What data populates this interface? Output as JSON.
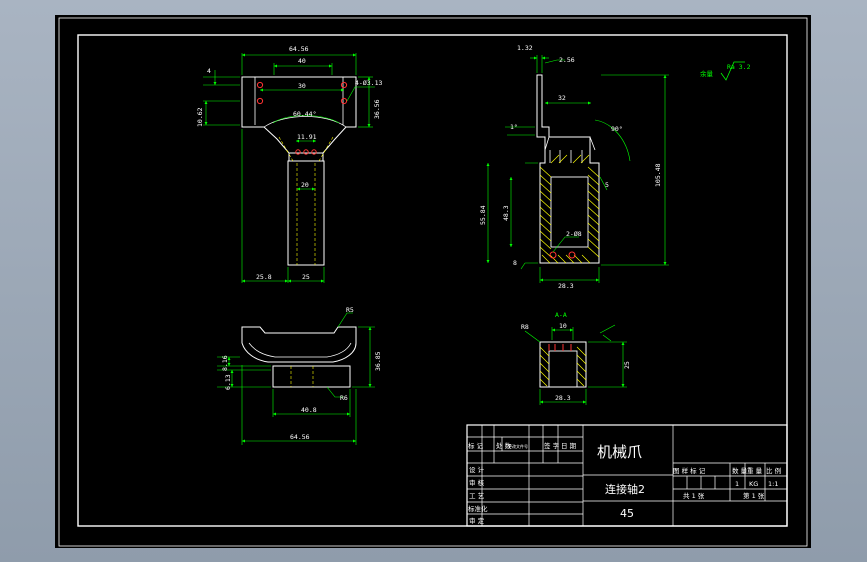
{
  "window": {
    "background": "#a9b4c2"
  },
  "colors": {
    "sheet": "#000000",
    "outline": "#ffffff",
    "dimension": "#00ff00",
    "hidden": "#ffff00",
    "hole": "#ff3333"
  },
  "front_view": {
    "dims": {
      "top_width": "64.56",
      "inner_width": "40",
      "slot_width": "30",
      "left_tab": "4",
      "holes": "4-Ø3.13",
      "arc_angle": "60.44°",
      "small_width": "11.91",
      "shaft_width": "20",
      "left_height": "10.62",
      "right_height": "36.56",
      "bottom_left": "25.8",
      "bottom_right": "25"
    }
  },
  "side_view": {
    "dims": {
      "top_offset": "1.32",
      "tab": "2.56",
      "width_top": "32",
      "angle_left": "1°",
      "angle_right": "90°",
      "chamfer": "5",
      "overall_height": "105.48",
      "wall_height": "55.84",
      "inner_height": "48.3",
      "hole_note": "2-Ø8",
      "base_width": "28.3",
      "base_small": "8"
    }
  },
  "roughness": {
    "label": "余量",
    "value": "Ra 3.2"
  },
  "top_view": {
    "dims": {
      "radius": "R5",
      "height_a": "8.16",
      "height_b": "6.13",
      "total_height": "36.85",
      "inner_width": "40.8",
      "overall_width": "64.56",
      "lip": "R6"
    }
  },
  "section_view": {
    "label": "A-A",
    "dims": {
      "left": "R8",
      "top_width": "10",
      "height": "25",
      "width": "28.3"
    }
  },
  "title_block": {
    "product_name": "机械爪",
    "part_name": "连接轴2",
    "material": "45",
    "rev_headers": [
      "标 记",
      "处 数",
      "更改文件号",
      "签 字",
      "日 期"
    ],
    "row_labels": [
      "设 计",
      "审 核",
      "工 艺",
      "标准化",
      "审 定"
    ],
    "info_headers": [
      "图 样 标 记",
      "数 量",
      "重 量",
      "比 例"
    ],
    "quantity": "1",
    "weight": "KG",
    "scale": "1:1",
    "total_sheets": "共 1 张",
    "sheet_no": "第 1 张"
  }
}
